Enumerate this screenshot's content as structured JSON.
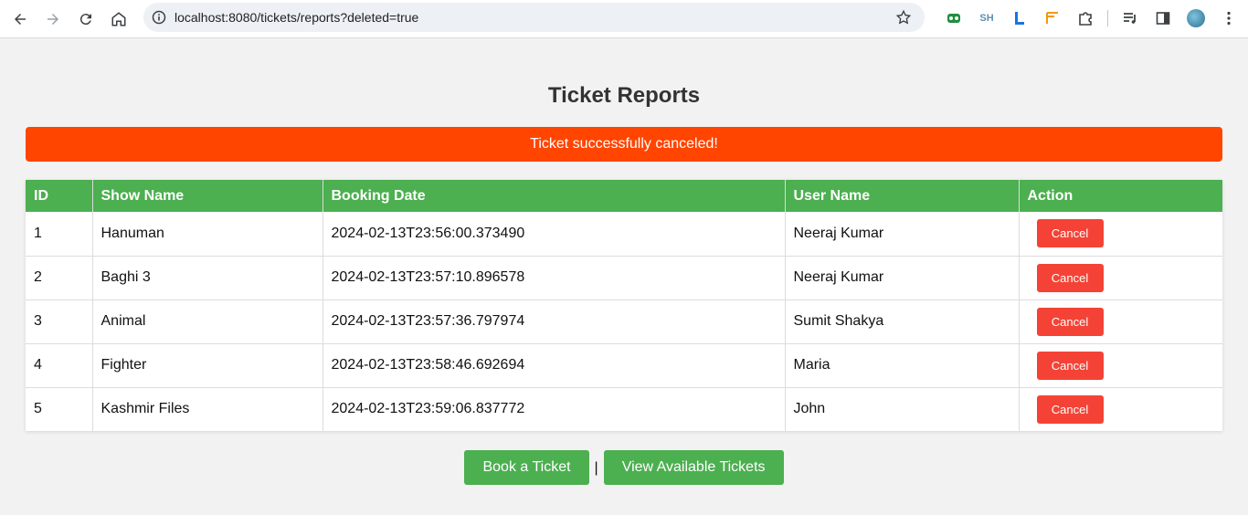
{
  "browser": {
    "url": "localhost:8080/tickets/reports?deleted=true",
    "extensions": {
      "sh_label": "SH"
    }
  },
  "page": {
    "title": "Ticket Reports",
    "alert": "Ticket successfully canceled!",
    "columns": [
      "ID",
      "Show Name",
      "Booking Date",
      "User Name",
      "Action"
    ],
    "rows": [
      {
        "id": "1",
        "show": "Hanuman",
        "date": "2024-02-13T23:56:00.373490",
        "user": "Neeraj Kumar",
        "action": "Cancel"
      },
      {
        "id": "2",
        "show": "Baghi 3",
        "date": "2024-02-13T23:57:10.896578",
        "user": "Neeraj Kumar",
        "action": "Cancel"
      },
      {
        "id": "3",
        "show": "Animal",
        "date": "2024-02-13T23:57:36.797974",
        "user": "Sumit Shakya",
        "action": "Cancel"
      },
      {
        "id": "4",
        "show": "Fighter",
        "date": "2024-02-13T23:58:46.692694",
        "user": "Maria",
        "action": "Cancel"
      },
      {
        "id": "5",
        "show": "Kashmir Files",
        "date": "2024-02-13T23:59:06.837772",
        "user": "John",
        "action": "Cancel"
      }
    ],
    "book_label": "Book a Ticket",
    "separator": "|",
    "view_label": "View Available Tickets"
  },
  "colors": {
    "alert": "#ff4500",
    "header": "#4caf50",
    "cancel": "#f44336",
    "green_button": "#4caf50"
  }
}
